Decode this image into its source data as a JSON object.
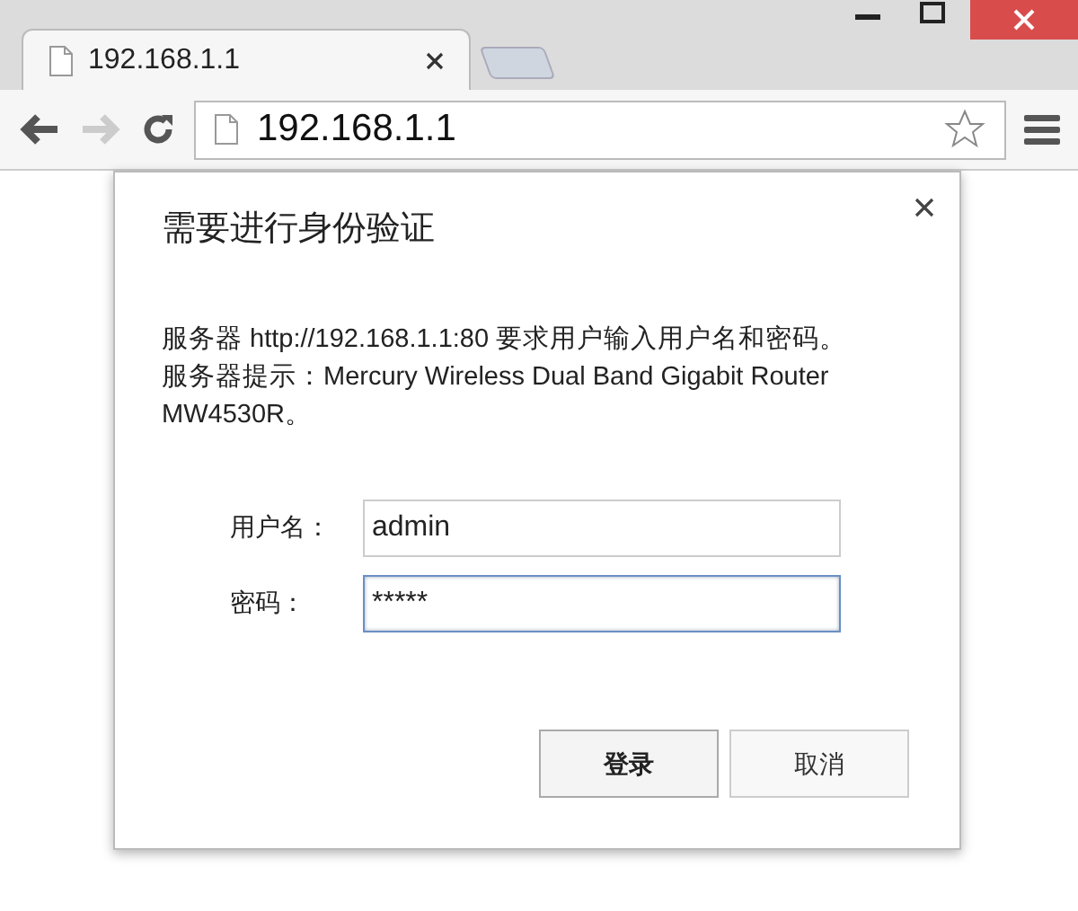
{
  "tabs": [
    {
      "title": "192.168.1.1",
      "selected": true
    }
  ],
  "address_bar": {
    "value": "192.168.1.1"
  },
  "dialog": {
    "title": "需要进行身份验证",
    "message": [
      "服务器 http://192.168.1.1:80 要求用户输入用户名和密码。",
      "服务器提示：Mercury Wireless Dual Band Gigabit Router MW4530R。"
    ],
    "fields": [
      {
        "label": "用户名：",
        "value": "admin",
        "focused": false
      },
      {
        "label": "密码：",
        "value": "*****",
        "focused": true
      }
    ],
    "buttons": [
      {
        "label": "登录",
        "kind": "primary"
      },
      {
        "label": "取消",
        "kind": "secondary"
      }
    ]
  }
}
